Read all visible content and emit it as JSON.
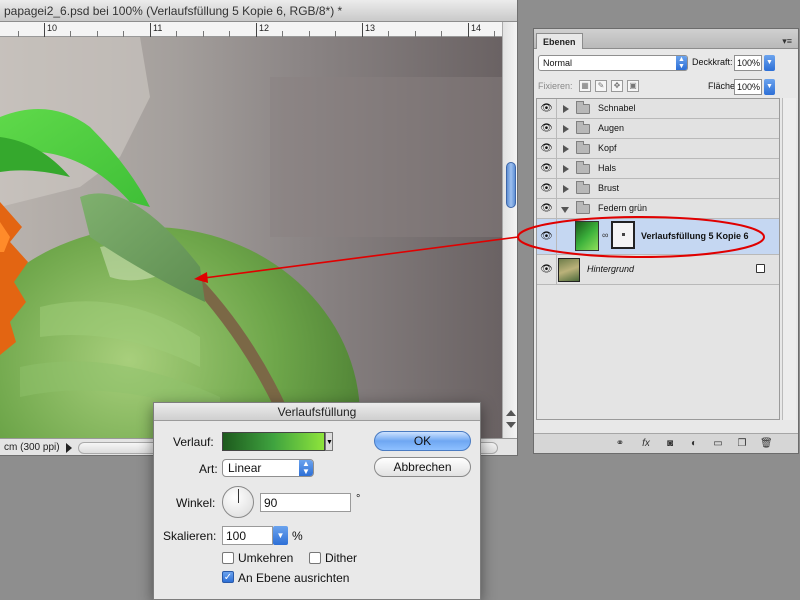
{
  "document": {
    "title": "papagei2_6.psd bei 100% (Verlaufsfüllung 5 Kopie 6, RGB/8*) *",
    "ruler_labels": [
      "10",
      "11",
      "12",
      "13",
      "14"
    ],
    "status_text": "cm (300 ppi)"
  },
  "layers_panel": {
    "tab_label": "Ebenen",
    "blend_mode": "Normal",
    "opacity_label": "Deckkraft:",
    "opacity_value": "100%",
    "lock_label": "Fixieren:",
    "fill_label": "Fläche:",
    "fill_value": "100%",
    "layers": [
      {
        "name": "Schnabel",
        "type": "group"
      },
      {
        "name": "Augen",
        "type": "group"
      },
      {
        "name": "Kopf",
        "type": "group"
      },
      {
        "name": "Hals",
        "type": "group"
      },
      {
        "name": "Brust",
        "type": "group"
      },
      {
        "name": "Federn grün",
        "type": "group-open"
      },
      {
        "name": "Verlaufsfüllung 5 Kopie 6",
        "type": "fill-layer",
        "selected": true
      },
      {
        "name": "Hintergrund",
        "type": "background",
        "locked": true
      }
    ],
    "footer_icons": [
      "link-icon",
      "fx-icon",
      "mask-icon",
      "adjustment-icon",
      "folder-icon",
      "new-layer-icon",
      "trash-icon"
    ]
  },
  "dialog": {
    "title": "Verlaufsfüllung",
    "gradient_label": "Verlauf:",
    "style_label": "Art:",
    "style_value": "Linear",
    "angle_label": "Winkel:",
    "angle_value": "90",
    "angle_unit": "°",
    "scale_label": "Skalieren:",
    "scale_value": "100",
    "scale_unit": "%",
    "reverse_label": "Umkehren",
    "dither_label": "Dither",
    "align_label": "An Ebene ausrichten",
    "reverse_checked": false,
    "dither_checked": false,
    "align_checked": true,
    "ok_label": "OK",
    "cancel_label": "Abbrechen"
  },
  "colors": {
    "annotation": "#e00000",
    "selection": "#c5d7f2",
    "accent": "#2d6fd6"
  }
}
